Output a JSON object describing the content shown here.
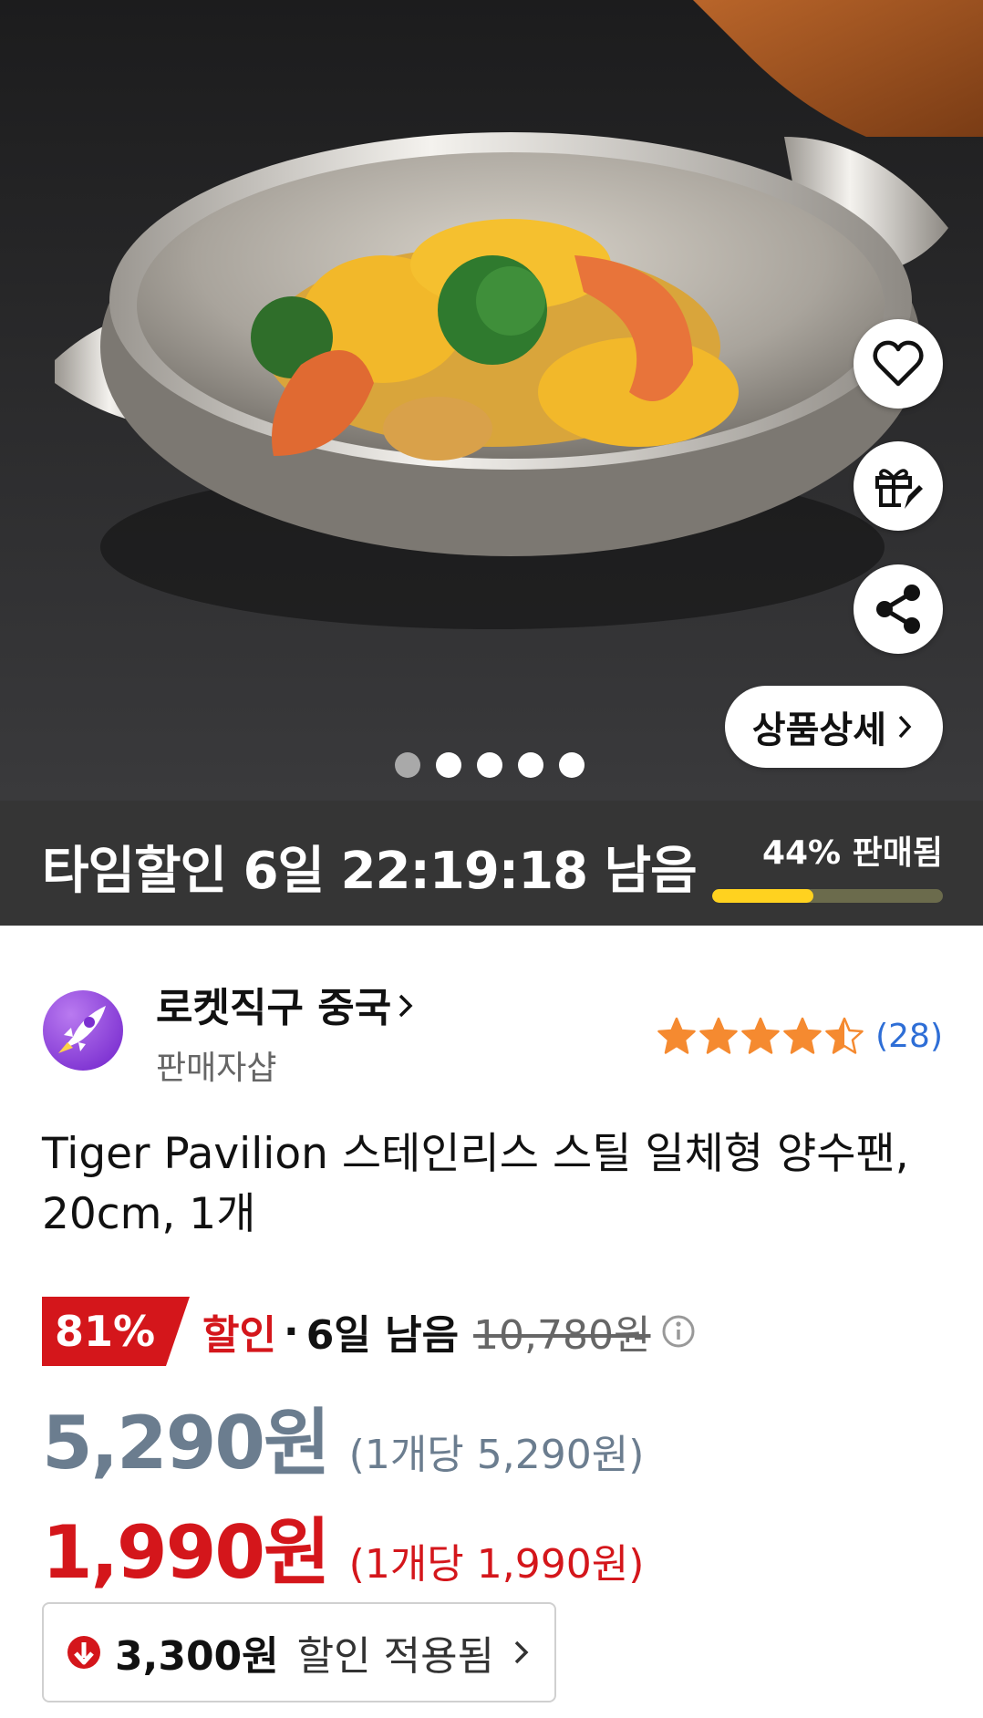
{
  "hero": {
    "detail_button_label": "상품상세",
    "image_count": 5,
    "active_image": 1
  },
  "time_deal": {
    "title": "타임할인 6일 22:19:18 남음",
    "sold_label": "44% 판매됨",
    "sold_fraction": 0.44
  },
  "seller": {
    "name": "로켓직구 중국",
    "subtitle": "판매자샵",
    "rating": 4.5,
    "review_count": "(28)"
  },
  "product": {
    "title": "Tiger Pavilion 스테인리스 스틸 일체형 양수팬, 20cm, 1개"
  },
  "pricing": {
    "discount_percent": "81%",
    "discount_word": "할인",
    "separator": "·",
    "days_left": "6일 남음",
    "original_price": "10,780원",
    "price": "5,290원",
    "unit_price": "(1개당 5,290원)",
    "final_price": "1,990원",
    "final_unit_price": "(1개당 1,990원)",
    "applied_amount": "3,300원",
    "applied_text": "할인 적용됨"
  },
  "colors": {
    "accent_red": "#d4161b",
    "deal_bar": "#353535",
    "progress_yellow": "#ffd21f",
    "star_orange": "#f58a30",
    "review_blue": "#2e6ed6",
    "price_gray": "#6b7d8f"
  }
}
